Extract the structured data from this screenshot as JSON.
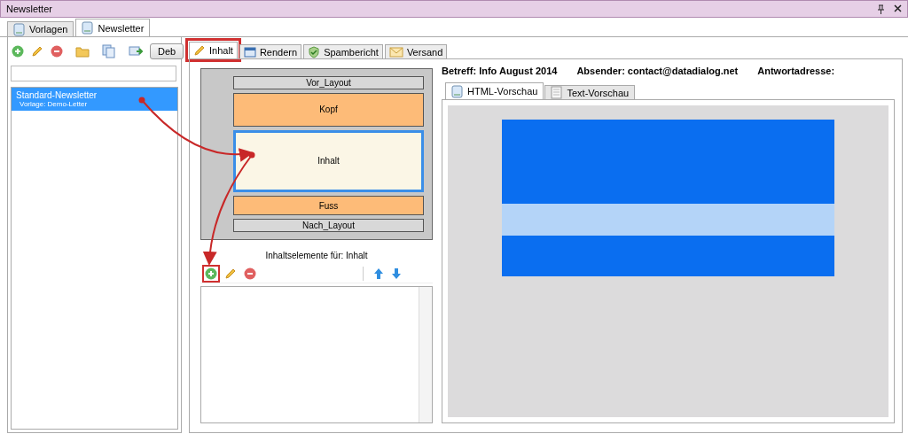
{
  "window": {
    "title": "Newsletter"
  },
  "doc_tabs": [
    {
      "label": "Vorlagen",
      "selected": false
    },
    {
      "label": "Newsletter",
      "selected": true
    }
  ],
  "left_toolbar": {
    "tools": [
      {
        "kind": "add"
      },
      {
        "kind": "edit"
      },
      {
        "kind": "delete"
      },
      {
        "kind": "folder"
      },
      {
        "kind": "copy"
      },
      {
        "kind": "send"
      }
    ],
    "button": "Deb"
  },
  "newsletters": [
    {
      "name": "Standard-Newsletter",
      "template": "Vorlage: Demo-Letter",
      "selected": true
    }
  ],
  "main_tabs": [
    {
      "label": "Inhalt",
      "kind": "edit",
      "selected": true,
      "highlighted": true
    },
    {
      "label": "Rendern",
      "kind": "window",
      "selected": false,
      "highlighted": false
    },
    {
      "label": "Spambericht",
      "kind": "shield",
      "selected": false,
      "highlighted": false
    },
    {
      "label": "Versand",
      "kind": "mail",
      "selected": false,
      "highlighted": false
    }
  ],
  "layout": [
    {
      "label": "Vor_Layout",
      "kind": "frame",
      "selected": false
    },
    {
      "label": "Kopf",
      "kind": "section",
      "selected": false
    },
    {
      "label": "Inhalt",
      "kind": "section",
      "selected": true
    },
    {
      "label": "Fuss",
      "kind": "section",
      "selected": false
    },
    {
      "label": "Nach_Layout",
      "kind": "frame",
      "selected": false
    }
  ],
  "elements": {
    "caption": "Inhaltselemente für: Inhalt",
    "tools": [
      {
        "kind": "add",
        "highlighted": true
      },
      {
        "kind": "edit",
        "highlighted": false
      },
      {
        "kind": "delete",
        "highlighted": false
      },
      {
        "kind": "up",
        "highlighted": false
      },
      {
        "kind": "down",
        "highlighted": false
      }
    ]
  },
  "header": [
    "Betreff: Info August 2014",
    "Absender: contact@datadialog.net",
    "Antwortadresse:"
  ],
  "preview_tabs": [
    {
      "label": "HTML-Vorschau",
      "selected": true
    },
    {
      "label": "Text-Vorschau",
      "selected": false
    }
  ]
}
